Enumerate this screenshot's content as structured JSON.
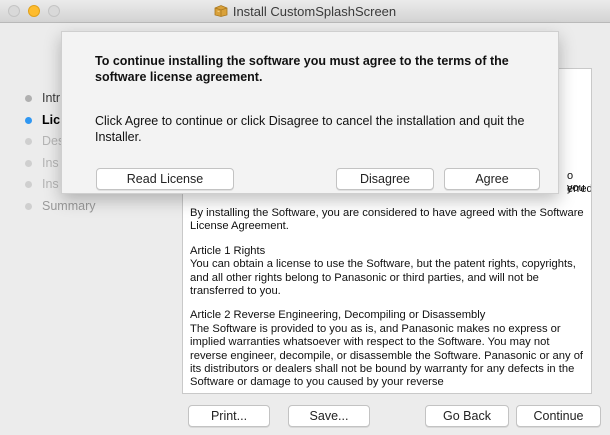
{
  "window": {
    "title": "Install CustomSplashScreen",
    "icon": "installer-package-icon"
  },
  "sidebar": {
    "steps": [
      {
        "label": "Intr",
        "state": "done"
      },
      {
        "label": "Lic",
        "state": "active"
      },
      {
        "label": "Des",
        "state": "pending"
      },
      {
        "label": "Ins",
        "state": "pending"
      },
      {
        "label": "Ins",
        "state": "pending"
      },
      {
        "label": "Summary",
        "state": "pending"
      }
    ]
  },
  "dialog": {
    "heading": "To continue installing the software you must agree to the terms of the software license agreement.",
    "body": "Click Agree to continue or click Disagree to cancel the installation and quit the Installer.",
    "read_license": "Read License",
    "disagree": "Disagree",
    "agree": "Agree"
  },
  "license": {
    "peek_1": "o you",
    "peek_2": "erred",
    "intro": "By installing the Software, you are considered to have agreed with the Software License Agreement.",
    "article1_title": "Article 1 Rights",
    "article1_body": "You can obtain a license to use the Software, but the patent rights, copyrights, and all other rights belong to Panasonic or third parties, and will not be transferred to you.",
    "article2_title": "Article 2 Reverse Engineering, Decompiling or Disassembly",
    "article2_body": "The Software is provided to you as is, and Panasonic makes no express or implied warranties whatsoever with respect to the Software. You may not reverse engineer, decompile, or disassemble the Software. Panasonic or any of its distributors or dealers shall not be bound by warranty for any defects in the Software or damage to you caused by your reverse"
  },
  "footer": {
    "print": "Print...",
    "save": "Save...",
    "go_back": "Go Back",
    "continue": "Continue"
  },
  "colors": {
    "active_step_dot": "#2f97f2",
    "minimize_light": "#febc2e"
  }
}
